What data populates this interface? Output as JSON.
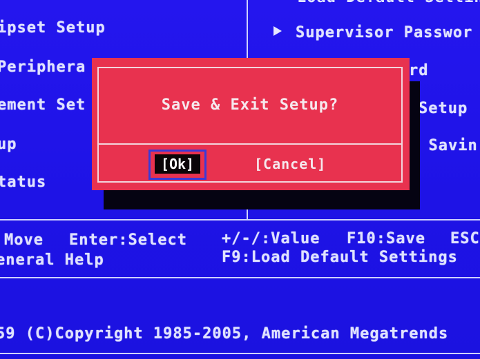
{
  "left_menu": [
    "ipset Setup",
    "Periphera",
    "ement Set",
    "up",
    "tatus"
  ],
  "right_menu": {
    "top_partial": "Load Default Settings",
    "supervisor": "Supervisor Passwor",
    "item2": "rd",
    "item3": "Setup",
    "item4": "t Savin"
  },
  "dialog": {
    "title": "Save & Exit Setup?",
    "ok_label": "[Ok]",
    "cancel_label": "[Cancel]"
  },
  "help": {
    "move": "Move",
    "enter": "Enter:Select",
    "value": "+/-/:Value",
    "f10": "F10:Save",
    "esc": "ESC",
    "general": "eneral Help",
    "f9": "F9:Load Default Settings"
  },
  "footer": {
    "copyright": "59 (C)Copyright 1985-2005, American Megatrends"
  },
  "colors": {
    "background": "#1f14e8",
    "dialog": "#e8324f",
    "text": "#dfe2ff"
  }
}
